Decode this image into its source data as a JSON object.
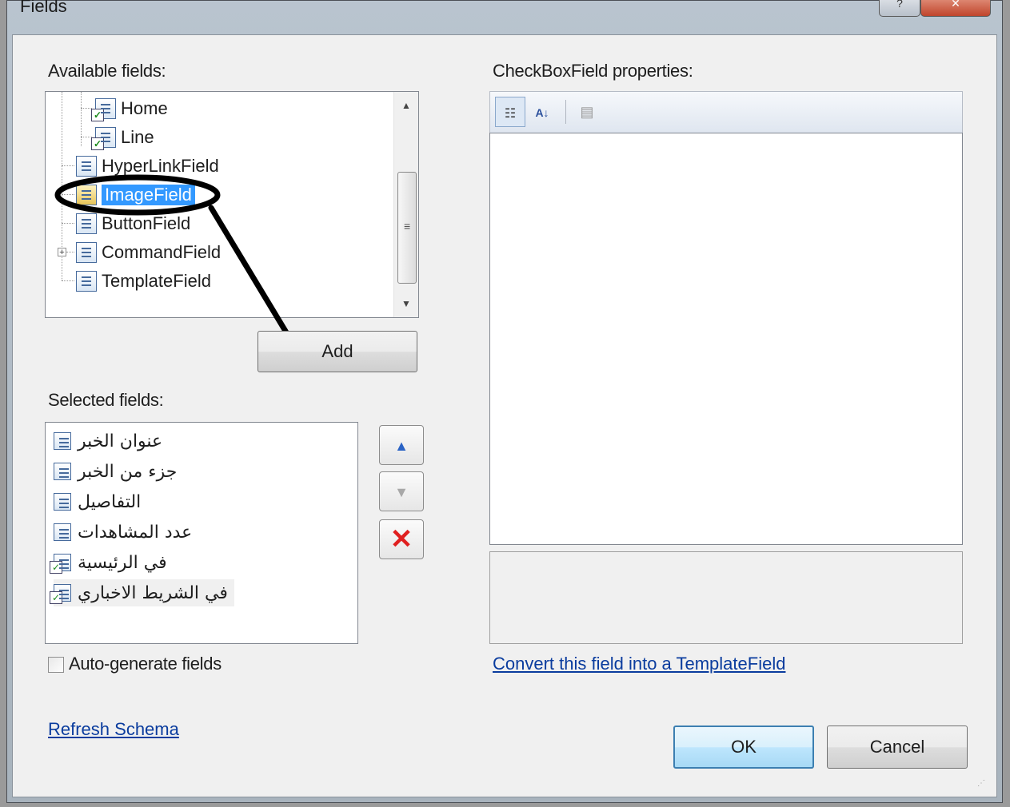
{
  "window": {
    "title": "Fields",
    "help_glyph": "?",
    "close_glyph": "✕"
  },
  "available": {
    "label": "Available fields:",
    "items": [
      {
        "label": "Home"
      },
      {
        "label": "Line"
      },
      {
        "label": "HyperLinkField"
      },
      {
        "label": "ImageField"
      },
      {
        "label": "ButtonField"
      },
      {
        "label": "CommandField"
      },
      {
        "label": "TemplateField"
      }
    ],
    "selected_item": "ImageField"
  },
  "add_button": "Add",
  "selected": {
    "label": "Selected fields:",
    "items": [
      {
        "label": "عنوان الخبر",
        "icon": "bound-field-icon"
      },
      {
        "label": "جزء من الخبر",
        "icon": "bound-field-icon"
      },
      {
        "label": "التفاصيل",
        "icon": "bound-field-icon"
      },
      {
        "label": "عدد المشاهدات",
        "icon": "bound-field-icon"
      },
      {
        "label": "في الرئيسية",
        "icon": "checkbox-field-icon"
      },
      {
        "label": "في الشريط الاخباري",
        "icon": "checkbox-field-icon"
      }
    ]
  },
  "auto_generate_label": "Auto-generate fields",
  "properties_label": "CheckBoxField properties:",
  "convert_link": "Convert this field into a TemplateField",
  "refresh_link": "Refresh Schema",
  "ok_button": "OK",
  "cancel_button": "Cancel",
  "colors": {
    "selection": "#3399ff",
    "link": "#0a3c9e",
    "delete": "#e02020",
    "arrow": "#2a63c5"
  }
}
